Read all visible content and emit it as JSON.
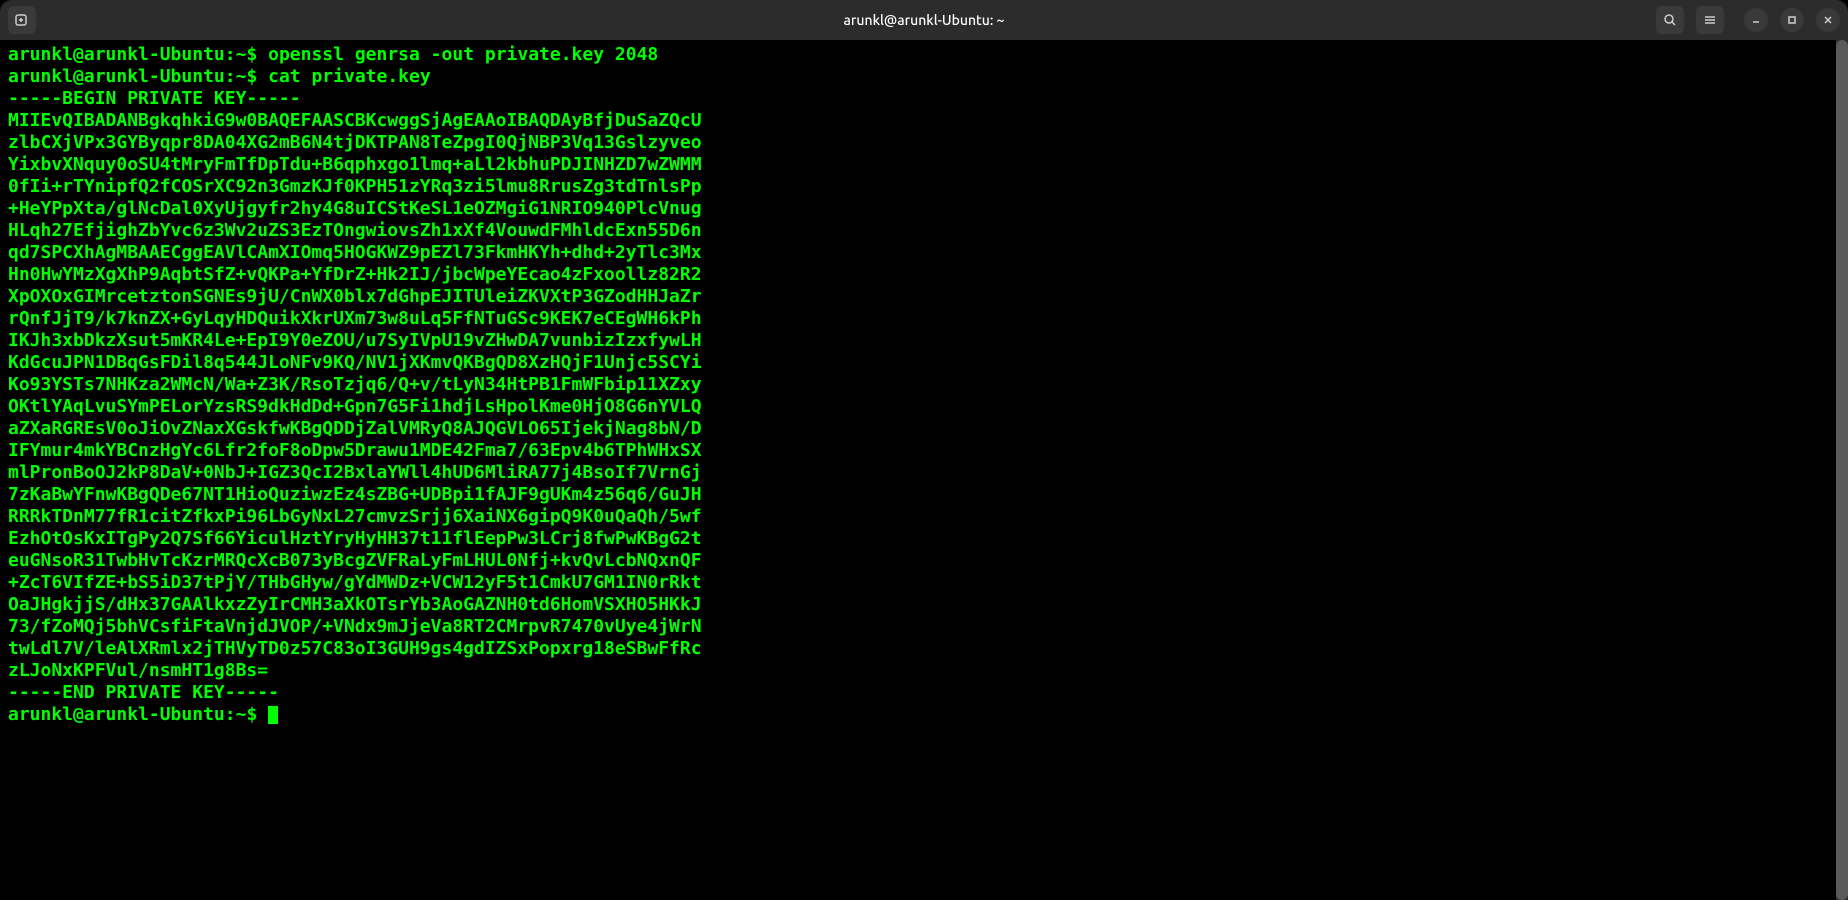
{
  "window": {
    "title": "arunkl@arunkl-Ubuntu: ~"
  },
  "prompt": {
    "user_host": "arunkl@arunkl-Ubuntu",
    "path": "~",
    "symbol": "$"
  },
  "commands": [
    {
      "cmd": "openssl genrsa -out private.key 2048"
    },
    {
      "cmd": "cat private.key"
    }
  ],
  "output": {
    "begin_marker": "-----BEGIN PRIVATE KEY-----",
    "end_marker": "-----END PRIVATE KEY-----",
    "key_lines": [
      "MIIEvQIBADANBgkqhkiG9w0BAQEFAASCBKcwggSjAgEAAoIBAQDAyBfjDuSaZQcU",
      "zlbCXjVPx3GYByqpr8DA04XG2mB6N4tjDKTPAN8TeZpgI0QjNBP3Vq13Gslzyveo",
      "YixbvXNquy0oSU4tMryFmTfDpTdu+B6qphxgo1lmq+aLl2kbhuPDJINHZD7wZWMM",
      "0fIi+rTYnipfQ2fCOSrXC92n3GmzKJf0KPH51zYRq3zi5lmu8RrusZg3tdTnlsPp",
      "+HeYPpXta/glNcDal0XyUjgyfr2hy4G8uICStKeSL1eOZMgiG1NRIO940PlcVnug",
      "HLqh27EfjighZbYvc6z3Wv2uZS3EzTOngwiovsZh1xXf4VouwdFMhldcExn55D6n",
      "qd7SPCXhAgMBAAECggEAVlCAmXIOmq5HOGKWZ9pEZl73FkmHKYh+dhd+2yTlc3Mx",
      "Hn0HwYMzXgXhP9AqbtSfZ+vQKPa+YfDrZ+Hk2IJ/jbcWpeYEcao4zFxoollz82R2",
      "XpOXOxGIMrcetztonSGNEs9jU/CnWX0blx7dGhpEJITUleiZKVXtP3GZodHHJaZr",
      "rQnfJjT9/k7knZX+GyLqyHDQuikXkrUXm73w8uLq5FfNTuGSc9KEK7eCEgWH6kPh",
      "IKJh3xbDkzXsut5mKR4Le+EpI9Y0eZOU/u7SyIVpU19vZHwDA7vunbizIzxfywLH",
      "KdGcuJPN1DBqGsFDil8q544JLoNFv9KQ/NV1jXKmvQKBgQD8XzHQjF1Unjc5SCYi",
      "Ko93YSTs7NHKza2WMcN/Wa+Z3K/RsoTzjq6/Q+v/tLyN34HtPB1FmWFbip11XZxy",
      "OKtlYAqLvuSYmPELorYzsRS9dkHdDd+Gpn7G5Fi1hdjLsHpolKme0HjO8G6nYVLQ",
      "aZXaRGREsV0oJiOvZNaxXGskfwKBgQDDjZalVMRyQ8AJQGVLO65IjekjNag8bN/D",
      "IFYmur4mkYBCnzHgYc6Lfr2foF8oDpw5Drawu1MDE42Fma7/63Epv4b6TPhWHxSX",
      "mlPronBoOJ2kP8DaV+0NbJ+IGZ3QcI2BxlaYWll4hUD6MliRA77j4BsoIf7VrnGj",
      "7zKaBwYFnwKBgQDe67NT1HioQuziwzEz4sZBG+UDBpi1fAJF9gUKm4z56q6/GuJH",
      "RRRkTDnM77fR1citZfkxPi96LbGyNxL27cmvzSrjj6XaiNX6gipQ9K0uQaQh/5wf",
      "EzhOtOsKxITgPy2Q7Sf66YiculHztYryHyHH37t11flEepPw3LCrj8fwPwKBgG2t",
      "euGNsoR31TwbHvTcKzrMRQcXcB073yBcgZVFRaLyFmLHUL0Nfj+kvQvLcbNQxnQF",
      "+ZcT6VIfZE+bS5iD37tPjY/THbGHyw/gYdMWDz+VCW12yF5t1CmkU7GM1IN0rRkt",
      "OaJHgkjjS/dHx37GAAlkxzZyIrCMH3aXkOTsrYb3AoGAZNH0td6HomVSXHO5HKkJ",
      "73/fZoMQj5bhVCsfiFtaVnjdJVOP/+VNdx9mJjeVa8RT2CMrpvR7470vUye4jWrN",
      "twLdl7V/leAlXRmlx2jTHVyTD0z57C83oI3GUH9gs4gdIZSxPopxrg18eSBwFfRc",
      "zLJoNxKPFVul/nsmHT1g8Bs="
    ]
  }
}
